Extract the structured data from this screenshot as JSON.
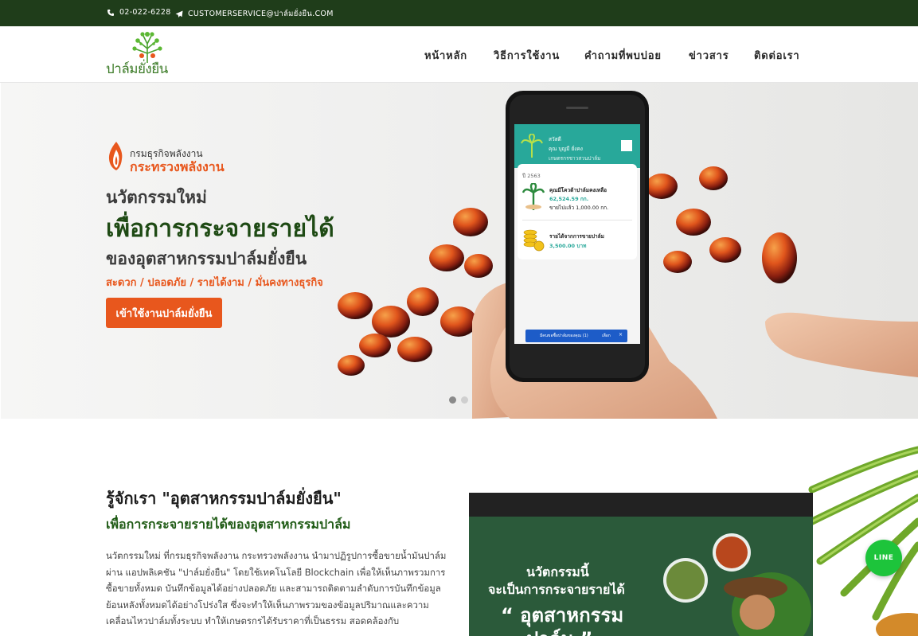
{
  "topbar": {
    "phone": "02-022-6228",
    "email": "CUSTOMERSERVICE@ปาล์มยั่งยืน.COM"
  },
  "header": {
    "logo_text": "ปาล์มยั่งยืน",
    "nav": [
      "หน้าหลัก",
      "วิธีการใช้งาน",
      "คำถามที่พบบ่อย",
      "ข่าวสาร",
      "ติดต่อเรา"
    ]
  },
  "hero": {
    "ministry_line1": "กรมธุรกิจพลังงาน",
    "ministry_line2": "กระทรวงพลังงาน",
    "subtitle1": "นวัตกรรมใหม่",
    "title": "เพื่อการกระจายรายได้",
    "subtitle2": "ของอุตสาหกรรมปาล์มยั่งยืน",
    "tagline": "สะดวก / ปลอดภัย / รายได้งาม / มั่นคงทางธุรกิจ",
    "cta": "เข้าใช้งานปาล์มยั่งยืน",
    "slides_total": 2,
    "slide_active": 1,
    "app_screen": {
      "name_line1": "สวัสดี",
      "name_line2": "คุณ บุญมี ยั่งคง",
      "name_line3": "เกษตรกรชาวสวนปาล์ม",
      "year": "ปี 2563",
      "quota_label": "คุณมีโควต้าปาล์มคงเหลือ",
      "quota_value": "62,524.59 กก.",
      "sold_label": "ขายไปแล้ว 1,000.00 กก.",
      "income_label": "รายได้จากการขายปาล์ม",
      "income_value": "3,500.00 บาท",
      "toast": "มีคนขอซื้อปาล์มของคุณ (1)",
      "toast_action": "เลือก"
    }
  },
  "about": {
    "title": "รู้จักเรา \"อุตสาหกรรมปาล์มยั่งยืน\"",
    "subtitle": "เพื่อการกระจายรายได้ของอุตสาหกรรมปาล์ม",
    "body": "นวัตกรรมใหม่ ที่กรมธุรกิจพลังงาน กระทรวงพลังงาน นำมาปฏิรูปการซื้อขายน้ำมันปาล์ม ผ่าน แอปพลิเคชัน \"ปาล์มยั่งยืน\" โดยใช้เทคโนโลยี Blockchain เพื่อให้เห็นภาพรวมการซื้อขายทั้งหมด บันทึกข้อมูลได้อย่างปลอดภัย และสามารถติดตามลำดับการบันทึกข้อมูลย้อนหลังทั้งหมดได้อย่างโปร่งใส ซึ่งจะทำให้เห็นภาพรวมของข้อมูลปริมาณและความเคลื่อนไหวปาล์มทั้งระบบ ทำให้เกษตรกรได้รับราคาที่เป็นธรรม สอดคล้องกับ",
    "video_line1": "นวัตกรรมนี้",
    "video_line2": "จะเป็นการกระจายรายได้",
    "video_line3": "“ อุตสาหกรรม",
    "video_line4": "ปาล์ม ”"
  },
  "floating": {
    "line_label": "LINE"
  },
  "colors": {
    "topbar_bg": "#1f3d1a",
    "accent_orange": "#e8571d",
    "brand_green": "#1e4a14",
    "line_green": "#1dc43b"
  }
}
